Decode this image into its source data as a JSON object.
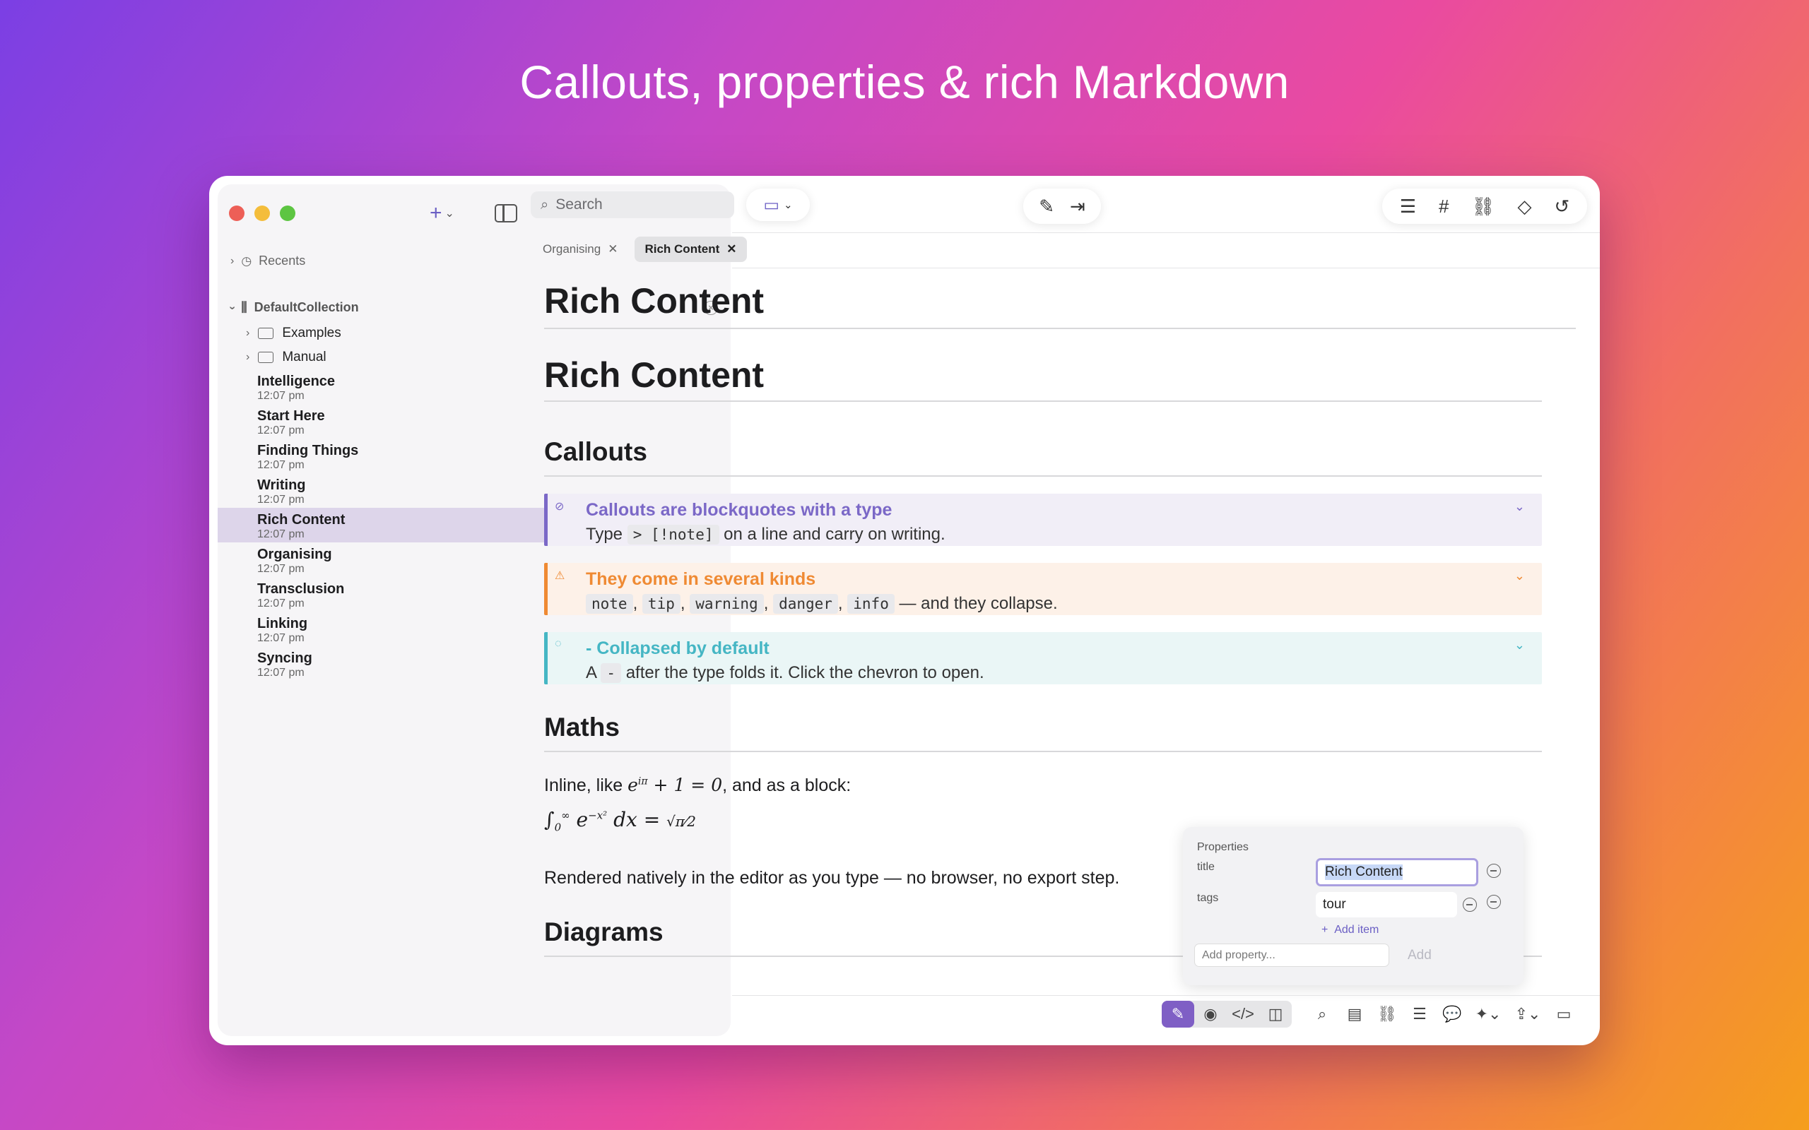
{
  "headline": "Callouts, properties & rich Markdown",
  "colors": {
    "accent": "#7f5fc5",
    "note": "#7b68c7",
    "warning": "#ef8a33",
    "info": "#45b6c4"
  },
  "sidebar": {
    "recents_label": "Recents",
    "collection": "DefaultCollection",
    "folders": [
      "Examples",
      "Manual"
    ],
    "docs": [
      {
        "title": "Intelligence",
        "time": "12:07 pm"
      },
      {
        "title": "Start Here",
        "time": "12:07 pm"
      },
      {
        "title": "Finding Things",
        "time": "12:07 pm"
      },
      {
        "title": "Writing",
        "time": "12:07 pm"
      },
      {
        "title": "Rich Content",
        "time": "12:07 pm"
      },
      {
        "title": "Organising",
        "time": "12:07 pm"
      },
      {
        "title": "Transclusion",
        "time": "12:07 pm"
      },
      {
        "title": "Linking",
        "time": "12:07 pm"
      },
      {
        "title": "Syncing",
        "time": "12:07 pm"
      }
    ]
  },
  "toolbar": {
    "search_placeholder": "Search"
  },
  "tabs": [
    {
      "label": "Organising"
    },
    {
      "label": "Rich Content"
    }
  ],
  "editor": {
    "title": "Rich Content",
    "h1": "Rich Content",
    "callouts_heading": "Callouts",
    "callout1": {
      "title": "Callouts are blockquotes with a type",
      "pre": "Type",
      "code": "> [!note]",
      "post": "on a line and carry on writing."
    },
    "callout2": {
      "title": "They come in several kinds",
      "codes": [
        "note",
        "tip",
        "warning",
        "danger",
        "info"
      ],
      "post": "— and they collapse."
    },
    "callout3": {
      "title": "- Collapsed by default",
      "pre": "A",
      "code": "-",
      "post": "after the type folds it. Click the chevron to open."
    },
    "maths_heading": "Maths",
    "maths_line_pre": "Inline, like",
    "maths_line_post": ", and as a block:",
    "maths_rendered": "Rendered natively in the editor as you type — no browser, no export step.",
    "diagrams_heading": "Diagrams"
  },
  "properties": {
    "heading": "Properties",
    "title_label": "title",
    "title_value": "Rich Content",
    "tags_label": "tags",
    "tags_value": "tour",
    "add_item": "Add item",
    "add_property_placeholder": "Add property...",
    "add_button": "Add"
  }
}
